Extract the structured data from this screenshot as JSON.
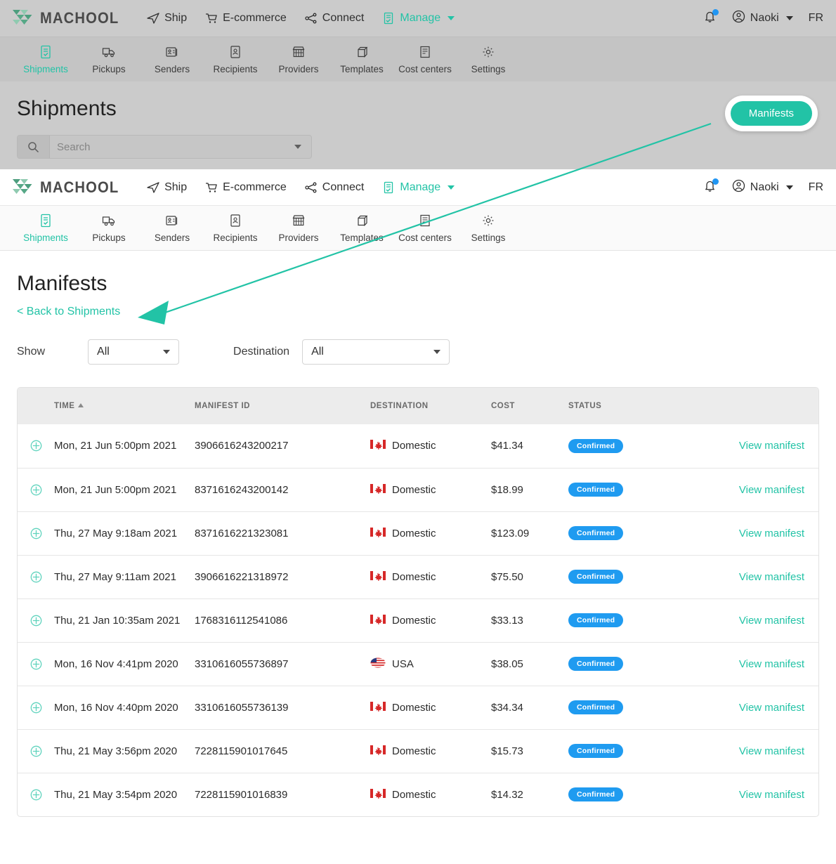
{
  "brand": {
    "name": "MACHOOL",
    "accent": "#22c3a6",
    "badge_blue": "#1f9bf0",
    "logo_icon": "machool-chevron-logo"
  },
  "top_nav": {
    "items": [
      {
        "label": "Ship",
        "icon": "paper-plane-icon",
        "active": false
      },
      {
        "label": "E-commerce",
        "icon": "shopping-cart-icon",
        "active": false
      },
      {
        "label": "Connect",
        "icon": "connect-nodes-icon",
        "active": false
      },
      {
        "label": "Manage",
        "icon": "clipboard-check-icon",
        "active": true,
        "has_caret": true
      }
    ],
    "right": {
      "notifications_icon": "bell-icon",
      "notification_dot": true,
      "user_icon": "user-circle-icon",
      "user_name": "Naoki",
      "language": "FR"
    }
  },
  "sub_nav": {
    "items": [
      {
        "label": "Shipments",
        "icon": "document-check-icon",
        "active": true
      },
      {
        "label": "Pickups",
        "icon": "delivery-truck-icon",
        "active": false
      },
      {
        "label": "Senders",
        "icon": "id-card-icon",
        "active": false
      },
      {
        "label": "Recipients",
        "icon": "contact-card-icon",
        "active": false
      },
      {
        "label": "Providers",
        "icon": "storefront-icon",
        "active": false
      },
      {
        "label": "Templates",
        "icon": "box-icon",
        "active": false
      },
      {
        "label": "Cost centers",
        "icon": "ledger-icon",
        "active": false
      },
      {
        "label": "Settings",
        "icon": "gear-icon",
        "active": false
      }
    ]
  },
  "shipments_panel": {
    "title": "Shipments",
    "search": {
      "placeholder": "Search",
      "value": "",
      "icon": "search-icon"
    },
    "manifests_button": "Manifests"
  },
  "manifests_page": {
    "title": "Manifests",
    "back_link": "< Back to Shipments",
    "filters": {
      "show_label": "Show",
      "show_value": "All",
      "destination_label": "Destination",
      "destination_value": "All"
    },
    "table": {
      "columns": [
        "TIME",
        "MANIFEST ID",
        "DESTINATION",
        "COST",
        "STATUS",
        ""
      ],
      "sorted_by": "TIME",
      "sort_direction": "asc",
      "action_label": "View manifest",
      "expand_icon": "plus-circle-icon",
      "rows": [
        {
          "time": "Mon, 21 Jun 5:00pm 2021",
          "manifest_id": "3906616243200217",
          "destination": "Domestic",
          "flag": "ca",
          "cost": "$41.34",
          "status": "Confirmed"
        },
        {
          "time": "Mon, 21 Jun 5:00pm 2021",
          "manifest_id": "8371616243200142",
          "destination": "Domestic",
          "flag": "ca",
          "cost": "$18.99",
          "status": "Confirmed"
        },
        {
          "time": "Thu, 27 May 9:18am 2021",
          "manifest_id": "8371616221323081",
          "destination": "Domestic",
          "flag": "ca",
          "cost": "$123.09",
          "status": "Confirmed"
        },
        {
          "time": "Thu, 27 May 9:11am 2021",
          "manifest_id": "3906616221318972",
          "destination": "Domestic",
          "flag": "ca",
          "cost": "$75.50",
          "status": "Confirmed"
        },
        {
          "time": "Thu, 21 Jan 10:35am 2021",
          "manifest_id": "1768316112541086",
          "destination": "Domestic",
          "flag": "ca",
          "cost": "$33.13",
          "status": "Confirmed"
        },
        {
          "time": "Mon, 16 Nov 4:41pm 2020",
          "manifest_id": "3310616055736897",
          "destination": "USA",
          "flag": "us",
          "cost": "$38.05",
          "status": "Confirmed"
        },
        {
          "time": "Mon, 16 Nov 4:40pm 2020",
          "manifest_id": "3310616055736139",
          "destination": "Domestic",
          "flag": "ca",
          "cost": "$34.34",
          "status": "Confirmed"
        },
        {
          "time": "Thu, 21 May 3:56pm 2020",
          "manifest_id": "7228115901017645",
          "destination": "Domestic",
          "flag": "ca",
          "cost": "$15.73",
          "status": "Confirmed"
        },
        {
          "time": "Thu, 21 May 3:54pm 2020",
          "manifest_id": "7228115901016839",
          "destination": "Domestic",
          "flag": "ca",
          "cost": "$14.32",
          "status": "Confirmed"
        }
      ]
    }
  },
  "annotation": {
    "type": "arrow",
    "color": "#22c3a6",
    "from": "manifests-button",
    "to": "manifests-page-title"
  }
}
